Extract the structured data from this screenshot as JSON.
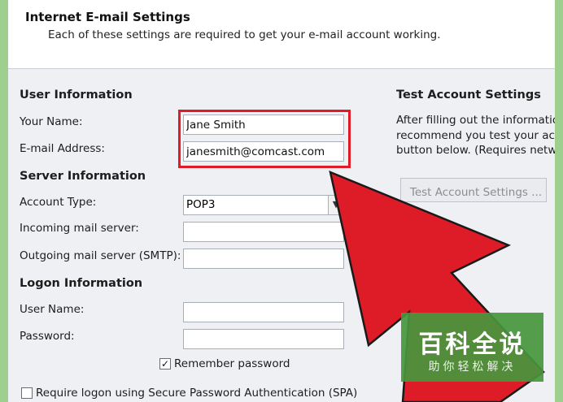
{
  "header": {
    "title": "Internet E-mail Settings",
    "subtitle": "Each of these settings are required to get your e-mail account working."
  },
  "user_info": {
    "heading": "User Information",
    "name_label": "Your Name:",
    "name_value": "Jane Smith",
    "email_label": "E-mail Address:",
    "email_value": "janesmith@comcast.com"
  },
  "server_info": {
    "heading": "Server Information",
    "account_type_label": "Account Type:",
    "account_type_value": "POP3",
    "incoming_label": "Incoming mail server:",
    "incoming_value": "",
    "outgoing_label": "Outgoing mail server (SMTP):",
    "outgoing_value": ""
  },
  "logon_info": {
    "heading": "Logon Information",
    "username_label": "User Name:",
    "username_value": "",
    "password_label": "Password:",
    "password_value": "",
    "remember_label": "Remember password",
    "remember_checked": true,
    "spa_label": "Require logon using Secure Password Authentication (SPA)",
    "spa_checked": false
  },
  "test_settings": {
    "heading": "Test Account Settings",
    "line1": "After filling out the information",
    "line2": "recommend you test your acco",
    "line3": "button below. (Requires netwo",
    "button_label": "Test Account Settings ..."
  },
  "watermark": {
    "main": "百科全说",
    "sub": "助你轻松解决"
  },
  "colors": {
    "highlight_red": "#e01b26",
    "arrow_red": "#dd1c27",
    "watermark_green": "#46963c"
  }
}
